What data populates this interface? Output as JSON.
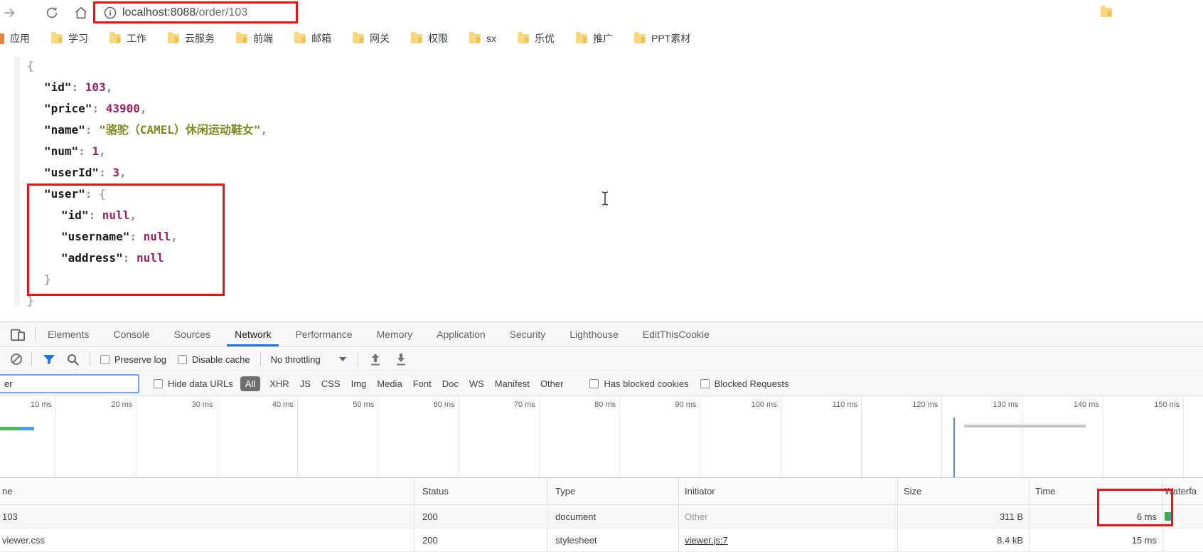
{
  "colors": {
    "annotation_red": "#ec1212",
    "accent_blue": "#1a73e8",
    "json_key": "#1a1a1a",
    "json_number": "#9a235f",
    "json_string": "#7b8a21",
    "json_punct": "#8a8a8a",
    "waterfall_green": "#3fae49",
    "waterfall_blue": "#4a9fe8",
    "dcl_marker_blue": "#5b87e5"
  },
  "nav": {
    "url_host": "localhost:8088",
    "url_path": "/order/103",
    "url_full": "localhost:8088/order/103"
  },
  "bookmarks": {
    "items": [
      "应用",
      "学习",
      "工作",
      "云服务",
      "前端",
      "邮箱",
      "网关",
      "权限",
      "sx",
      "乐优",
      "推广",
      "PPT素材"
    ]
  },
  "json_view": {
    "lines": [
      {
        "indent": 0,
        "tokens": [
          {
            "t": "{",
            "c": "brace"
          }
        ]
      },
      {
        "indent": 1,
        "tokens": [
          {
            "t": "\"id\"",
            "c": "key"
          },
          {
            "t": ": ",
            "c": "punct"
          },
          {
            "t": "103",
            "c": "num"
          },
          {
            "t": ",",
            "c": "punct"
          }
        ]
      },
      {
        "indent": 1,
        "tokens": [
          {
            "t": "\"price\"",
            "c": "key"
          },
          {
            "t": ": ",
            "c": "punct"
          },
          {
            "t": "43900",
            "c": "num"
          },
          {
            "t": ",",
            "c": "punct"
          }
        ]
      },
      {
        "indent": 1,
        "tokens": [
          {
            "t": "\"name\"",
            "c": "key"
          },
          {
            "t": ": ",
            "c": "punct"
          },
          {
            "t": "\"骆驼（CAMEL）休闲运动鞋女\"",
            "c": "str"
          },
          {
            "t": ",",
            "c": "punct"
          }
        ]
      },
      {
        "indent": 1,
        "tokens": [
          {
            "t": "\"num\"",
            "c": "key"
          },
          {
            "t": ": ",
            "c": "punct"
          },
          {
            "t": "1",
            "c": "num"
          },
          {
            "t": ",",
            "c": "punct"
          }
        ]
      },
      {
        "indent": 1,
        "tokens": [
          {
            "t": "\"userId\"",
            "c": "key"
          },
          {
            "t": ": ",
            "c": "punct"
          },
          {
            "t": "3",
            "c": "num"
          },
          {
            "t": ",",
            "c": "punct"
          }
        ]
      },
      {
        "indent": 1,
        "tokens": [
          {
            "t": "\"user\"",
            "c": "key"
          },
          {
            "t": ": ",
            "c": "punct"
          },
          {
            "t": "{",
            "c": "brace"
          }
        ]
      },
      {
        "indent": 2,
        "tokens": [
          {
            "t": "\"id\"",
            "c": "key"
          },
          {
            "t": ": ",
            "c": "punct"
          },
          {
            "t": "null",
            "c": "num"
          },
          {
            "t": ",",
            "c": "punct"
          }
        ]
      },
      {
        "indent": 2,
        "tokens": [
          {
            "t": "\"username\"",
            "c": "key"
          },
          {
            "t": ": ",
            "c": "punct"
          },
          {
            "t": "null",
            "c": "num"
          },
          {
            "t": ",",
            "c": "punct"
          }
        ]
      },
      {
        "indent": 2,
        "tokens": [
          {
            "t": "\"address\"",
            "c": "key"
          },
          {
            "t": ": ",
            "c": "punct"
          },
          {
            "t": "null",
            "c": "num"
          }
        ]
      },
      {
        "indent": 1,
        "tokens": [
          {
            "t": "}",
            "c": "brace"
          }
        ]
      },
      {
        "indent": 0,
        "tokens": [
          {
            "t": "}",
            "c": "brace"
          }
        ]
      }
    ]
  },
  "devtools": {
    "tabs": [
      {
        "label": "Elements",
        "active": false
      },
      {
        "label": "Console",
        "active": false
      },
      {
        "label": "Sources",
        "active": false
      },
      {
        "label": "Network",
        "active": true
      },
      {
        "label": "Performance",
        "active": false
      },
      {
        "label": "Memory",
        "active": false
      },
      {
        "label": "Application",
        "active": false
      },
      {
        "label": "Security",
        "active": false
      },
      {
        "label": "Lighthouse",
        "active": false
      },
      {
        "label": "EditThisCookie",
        "active": false
      }
    ],
    "toolbar": {
      "preserve_log": "Preserve log",
      "disable_cache": "Disable cache",
      "throttling": "No throttling"
    },
    "filterbar": {
      "input_value": "er",
      "hide_data_urls": "Hide data URLs",
      "types": [
        "All",
        "XHR",
        "JS",
        "CSS",
        "Img",
        "Media",
        "Font",
        "Doc",
        "WS",
        "Manifest",
        "Other"
      ],
      "selected_type": "All",
      "has_blocked_cookies": "Has blocked cookies",
      "blocked_requests": "Blocked Requests"
    },
    "timeline": {
      "labels": [
        "10 ms",
        "20 ms",
        "30 ms",
        "40 ms",
        "50 ms",
        "60 ms",
        "70 ms",
        "80 ms",
        "90 ms",
        "100 ms",
        "110 ms",
        "120 ms",
        "130 ms",
        "140 ms",
        "150 ms"
      ]
    },
    "table": {
      "headers": [
        "ne",
        "Status",
        "Type",
        "Initiator",
        "Size",
        "Time",
        "Waterfa"
      ],
      "rows": [
        {
          "name": "103",
          "status": "200",
          "type": "document",
          "initiator": "Other",
          "initiator_is_link": false,
          "size": "311 B",
          "time": "6 ms",
          "waterfall_bar": true
        },
        {
          "name": "viewer.css",
          "status": "200",
          "type": "stylesheet",
          "initiator": "viewer.js:7",
          "initiator_is_link": true,
          "size": "8.4 kB",
          "time": "15 ms",
          "waterfall_bar": false
        }
      ]
    }
  }
}
